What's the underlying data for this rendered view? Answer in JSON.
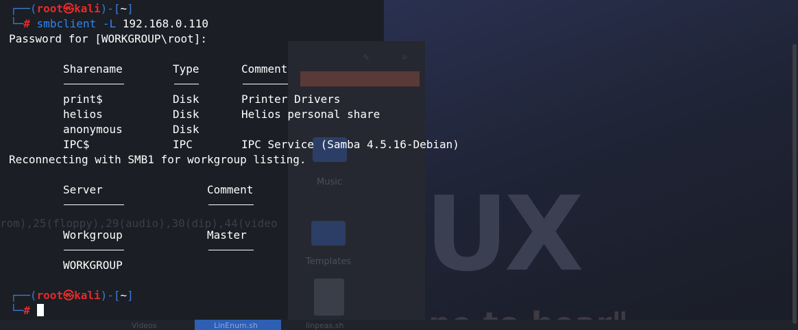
{
  "prompt": {
    "user": "root",
    "host": "kali",
    "dir": "~",
    "skull": "㉿",
    "hash": "#"
  },
  "command": {
    "name": "smbclient",
    "flag": "-L",
    "arg": "192.168.0.110"
  },
  "password_prompt": "Password for [WORKGROUP\\root]:",
  "shares": {
    "headers": [
      "Sharename",
      "Type",
      "Comment"
    ],
    "underlines": [
      "─────────",
      "────",
      "───────"
    ],
    "rows": [
      [
        "print$",
        "Disk",
        "Printer Drivers"
      ],
      [
        "helios",
        "Disk",
        "Helios personal share"
      ],
      [
        "anonymous",
        "Disk",
        ""
      ],
      [
        "IPC$",
        "IPC",
        "IPC Service (Samba 4.5.16-Debian)"
      ]
    ]
  },
  "reconnect": "Reconnecting with SMB1 for workgroup listing.",
  "servers": {
    "headers": [
      "Server",
      "Comment"
    ],
    "underlines": [
      "─────────",
      "───────"
    ]
  },
  "workgroups": {
    "headers": [
      "Workgroup",
      "Master"
    ],
    "underlines": [
      "─────────",
      "───────"
    ],
    "rows": [
      [
        "WORKGROUP",
        ""
      ]
    ]
  },
  "background": {
    "faded_text": "rom),25(floppy),29(audio),30(dip),44(video",
    "music_label": "Music",
    "templates_label": "Templates",
    "videos_label": "Videos",
    "linenum_label": "LinEnum.sh",
    "linpeas_label": "linpeas.sh",
    "logo_text": "UX",
    "logo_tagline": "ne to hear\""
  },
  "colors": {
    "prompt_frame": "#3c7bd8",
    "prompt_user": "#e52b2b",
    "command": "#2e86f0",
    "text": "#ffffff",
    "background": "#1b1e24"
  }
}
